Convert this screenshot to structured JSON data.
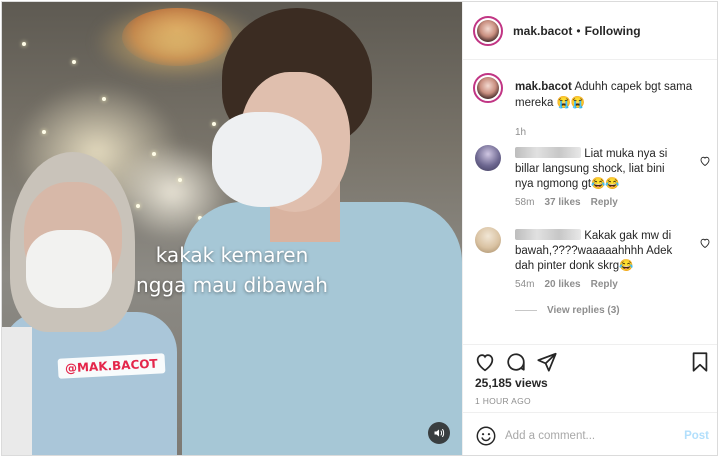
{
  "colors": {
    "accent": "#0095f6",
    "post_disabled": "#b2dffc",
    "muted": "#8e8e8e",
    "text": "#262626",
    "watermark_red": "#e4264b",
    "avatar_ring": "#c13584"
  },
  "video": {
    "caption_text": "kakak kemaren\nngga mau dibawah",
    "watermark": "@MAK.BACOT",
    "sound_icon": "speaker-icon"
  },
  "header": {
    "username": "mak.bacot",
    "separator": "•",
    "follow_status": "Following"
  },
  "post_caption": {
    "username": "mak.bacot",
    "text": "Aduhh capek bgt sama mereka 😭😭",
    "time": "1h"
  },
  "comments": [
    {
      "text": "Liat muka nya si billar langsung shock, liat bini nya ngmong gt😂😂",
      "time": "58m",
      "likes": "37 likes",
      "reply_label": "Reply"
    },
    {
      "text": "Kakak gak mw di bawah,????waaaaahhhh Adek dah pinter donk skrg😂",
      "time": "54m",
      "likes": "20 likes",
      "reply_label": "Reply",
      "view_replies": "View replies (3)"
    }
  ],
  "actions": {
    "icons": [
      "heart-icon",
      "comment-icon",
      "share-icon",
      "bookmark-icon"
    ]
  },
  "stats": {
    "views": "25,185 views",
    "posted_ago": "1 HOUR AGO"
  },
  "composer": {
    "placeholder": "Add a comment...",
    "post_label": "Post",
    "emoji_icon": "smiley-icon"
  }
}
